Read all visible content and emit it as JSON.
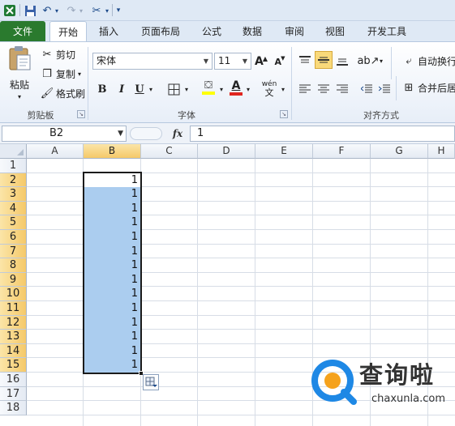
{
  "quick_access": {
    "save_icon": "save-icon",
    "undo_icon": "undo-icon",
    "redo_icon": "redo-icon",
    "tool_icon": "tools-icon",
    "customize_icon": "customize-qat-icon"
  },
  "tabs": [
    {
      "label": "文件",
      "kind": "file"
    },
    {
      "label": "开始",
      "kind": "active"
    },
    {
      "label": "插入"
    },
    {
      "label": "页面布局"
    },
    {
      "label": "公式"
    },
    {
      "label": "数据"
    },
    {
      "label": "审阅"
    },
    {
      "label": "视图"
    },
    {
      "label": "开发工具"
    }
  ],
  "ribbon": {
    "clipboard": {
      "paste_label": "粘贴",
      "cut_label": "剪切",
      "copy_label": "复制",
      "format_painter_label": "格式刷",
      "group_label": "剪贴板"
    },
    "font": {
      "font_name": "宋体",
      "font_size": "11",
      "bold": "B",
      "italic": "I",
      "underline": "U",
      "grow_font": "A",
      "shrink_font": "A",
      "font_color_glyph": "A",
      "phonetic_glyph": "wén",
      "group_label": "字体"
    },
    "alignment": {
      "wrap_text_label": "自动换行",
      "merge_center_label": "合并后居",
      "group_label": "对齐方式"
    }
  },
  "formula_bar": {
    "name_box": "B2",
    "fx_label": "fx",
    "formula": "1"
  },
  "sheet": {
    "columns": [
      "A",
      "B",
      "C",
      "D",
      "E",
      "F",
      "G",
      "H"
    ],
    "rows": [
      "1",
      "2",
      "3",
      "4",
      "5",
      "6",
      "7",
      "8",
      "9",
      "10",
      "11",
      "12",
      "13",
      "14",
      "15",
      "16",
      "17",
      "18"
    ],
    "selected_column": "B",
    "selected_rows": [
      "2",
      "3",
      "4",
      "5",
      "6",
      "7",
      "8",
      "9",
      "10",
      "11",
      "12",
      "13",
      "14",
      "15"
    ],
    "active_cell": "B2",
    "b_values": [
      "1",
      "1",
      "1",
      "1",
      "1",
      "1",
      "1",
      "1",
      "1",
      "1",
      "1",
      "1",
      "1",
      "1"
    ]
  },
  "watermark": {
    "title": "查询啦",
    "subtitle": "chaxunla.com"
  },
  "colors": {
    "file_tab": "#2a7a2e",
    "selection_fill": "#abcdef",
    "header_highlight": "#f5c969",
    "font_color_bar": "#e0261f",
    "highlight_bar": "#ffff00",
    "watermark_accent": "#1e88e5",
    "watermark_orange": "#f5a21d"
  }
}
